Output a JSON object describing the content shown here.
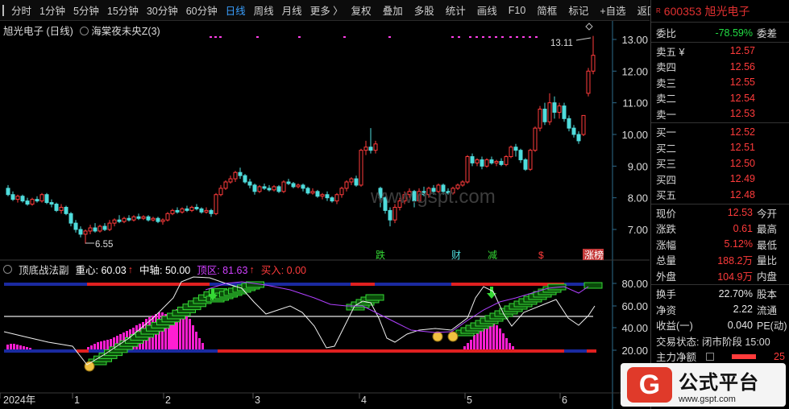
{
  "toolbar": {
    "periods": [
      "分时",
      "1分钟",
      "5分钟",
      "15分钟",
      "30分钟",
      "60分钟",
      "日线",
      "周线",
      "月线",
      "更多 〉"
    ],
    "active": "日线",
    "actions": [
      "复权",
      "叠加",
      "多股",
      "统计",
      "画线",
      "F10",
      "简框",
      "标记",
      "+自选",
      "返回"
    ]
  },
  "main_chart": {
    "legend_title": "旭光电子 (日线)",
    "indicator": "海棠夜未央Z(3)",
    "price_ticks": [
      "13.00",
      "12.00",
      "11.00",
      "10.00",
      "9.00",
      "8.00",
      "7.00"
    ],
    "high_label": "13.11",
    "low_label": "6.55",
    "event_labels": [
      "跌",
      "财",
      "减",
      "$",
      "涨榜"
    ]
  },
  "sub_chart": {
    "name": "顶底战法副",
    "center_label": "重心: 60.03",
    "axis_label": "中轴: 50.00",
    "top_label": "顶区: 81.63",
    "buy_label": "买入: 0.00",
    "ticks": [
      "80.00",
      "60.00",
      "40.00",
      "20.00"
    ]
  },
  "date_axis": [
    "2024年",
    "1",
    "2",
    "3",
    "4",
    "5",
    "6"
  ],
  "quote": {
    "code": "600353",
    "name": "旭光电子",
    "r_badge": "R",
    "weibi": {
      "label": "委比",
      "value": "-78.59%",
      "tail": "委差"
    },
    "asks": [
      {
        "label": "卖五 ¥",
        "price": "12.57"
      },
      {
        "label": "卖四",
        "price": "12.56"
      },
      {
        "label": "卖三",
        "price": "12.55"
      },
      {
        "label": "卖二",
        "price": "12.54"
      },
      {
        "label": "卖一",
        "price": "12.53"
      }
    ],
    "bids": [
      {
        "label": "买一",
        "price": "12.52"
      },
      {
        "label": "买二",
        "price": "12.51"
      },
      {
        "label": "买三",
        "price": "12.50"
      },
      {
        "label": "买四",
        "price": "12.49"
      },
      {
        "label": "买五",
        "price": "12.48"
      }
    ],
    "stats": [
      {
        "label": "现价",
        "value": "12.53",
        "tail": "今开"
      },
      {
        "label": "涨跌",
        "value": "0.61",
        "tail": "最高"
      },
      {
        "label": "涨幅",
        "value": "5.12%",
        "tail": "最低"
      },
      {
        "label": "总量",
        "value": "188.2万",
        "tail": "量比"
      },
      {
        "label": "外盘",
        "value": "104.9万",
        "tail": "内盘"
      }
    ],
    "stats2": [
      {
        "label": "换手",
        "value": "22.70%",
        "tail": "股本"
      },
      {
        "label": "净资",
        "value": "2.22",
        "tail": "流通"
      },
      {
        "label": "收益(一)",
        "value": "0.040",
        "tail": "PE(动)"
      }
    ],
    "status": "交易状态: 闭市阶段 15:00",
    "main_flow": {
      "label": "主力净额",
      "value": "25"
    }
  },
  "watermark": {
    "logo": "G",
    "title": "公式平台",
    "url": "www.gspt.com"
  },
  "colors": {
    "up": "#ff3b3b",
    "down": "#4fdcdc",
    "active": "#3aa0ff",
    "magenta": "#ff1ed2",
    "green": "#35d935"
  }
}
